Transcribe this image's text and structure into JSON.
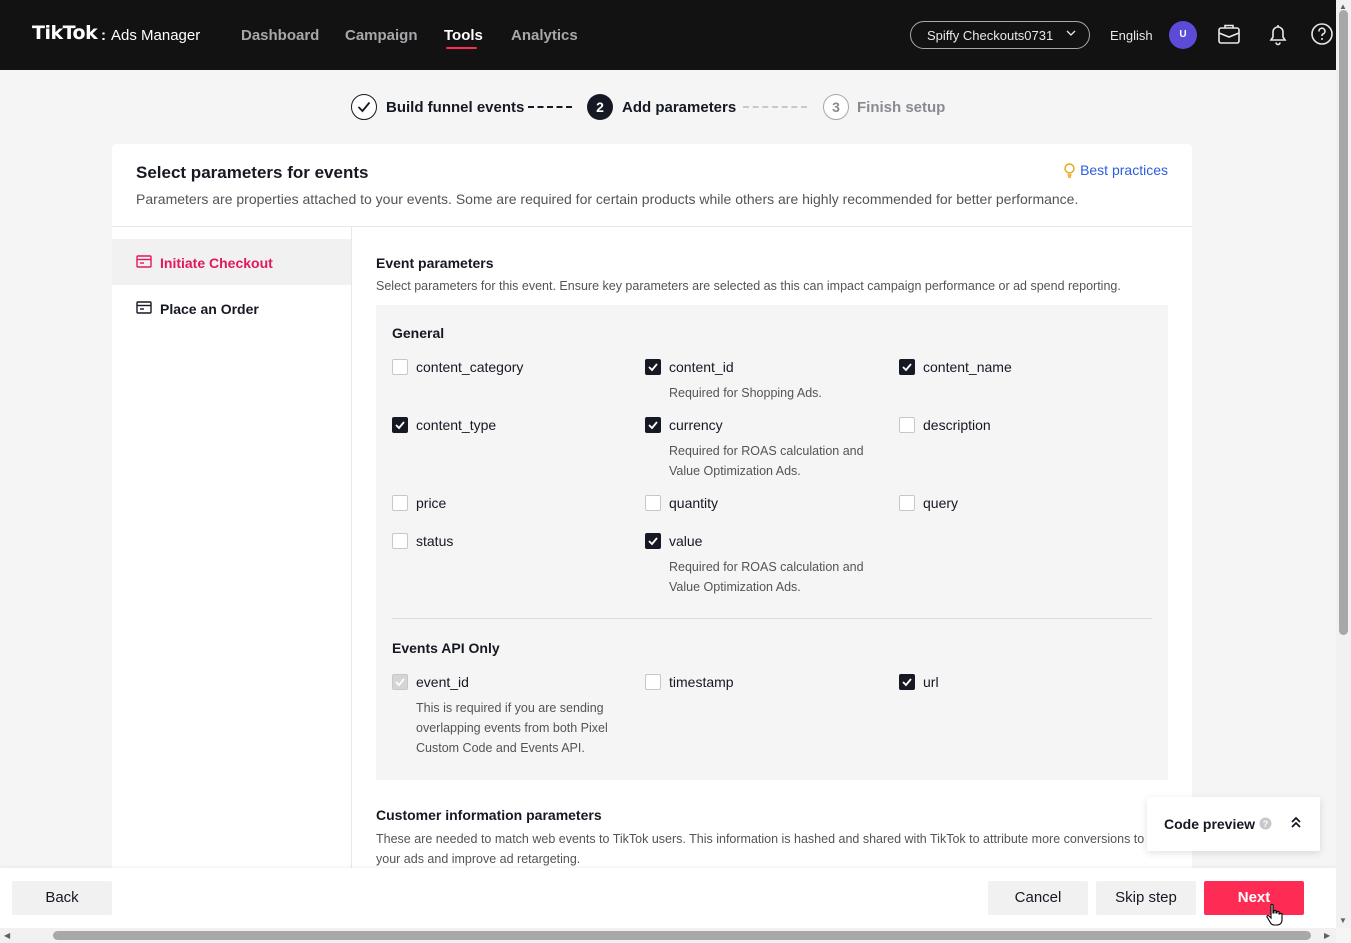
{
  "header": {
    "logo_brand": "TikTok",
    "logo_sub": "Ads Manager",
    "nav": [
      "Dashboard",
      "Campaign",
      "Tools",
      "Analytics"
    ],
    "active_nav": "Tools",
    "account": "Spiffy Checkouts0731",
    "language": "English",
    "avatar_initial": "U"
  },
  "stepper": {
    "steps": [
      {
        "number": "",
        "label": "Build funnel events",
        "state": "done"
      },
      {
        "number": "2",
        "label": "Add parameters",
        "state": "active"
      },
      {
        "number": "3",
        "label": "Finish setup",
        "state": "upcoming"
      }
    ]
  },
  "card": {
    "title": "Select parameters for events",
    "description": "Parameters are properties attached to your events. Some are required for certain products while others are highly recommended for better performance.",
    "best_practices": "Best practices"
  },
  "sidebar": {
    "items": [
      {
        "label": "Initiate Checkout",
        "active": true
      },
      {
        "label": "Place an Order",
        "active": false
      }
    ]
  },
  "event_parameters": {
    "title": "Event parameters",
    "description": "Select parameters for this event. Ensure key parameters are selected as this can impact campaign performance or ad spend reporting.",
    "general": {
      "title": "General",
      "params": [
        {
          "name": "content_category",
          "checked": false,
          "hint": ""
        },
        {
          "name": "content_id",
          "checked": true,
          "hint": "Required for Shopping Ads."
        },
        {
          "name": "content_name",
          "checked": true,
          "hint": ""
        },
        {
          "name": "content_type",
          "checked": true,
          "hint": ""
        },
        {
          "name": "currency",
          "checked": true,
          "hint": "Required for ROAS calculation and Value Optimization Ads."
        },
        {
          "name": "description",
          "checked": false,
          "hint": ""
        },
        {
          "name": "price",
          "checked": false,
          "hint": ""
        },
        {
          "name": "quantity",
          "checked": false,
          "hint": ""
        },
        {
          "name": "query",
          "checked": false,
          "hint": ""
        },
        {
          "name": "status",
          "checked": false,
          "hint": ""
        },
        {
          "name": "value",
          "checked": true,
          "hint": "Required for ROAS calculation and Value Optimization Ads."
        }
      ]
    },
    "events_api": {
      "title": "Events API Only",
      "params": [
        {
          "name": "event_id",
          "checked": true,
          "disabled": true,
          "hint": "This is required if you are sending overlapping events from both Pixel Custom Code and Events API."
        },
        {
          "name": "timestamp",
          "checked": false,
          "hint": ""
        },
        {
          "name": "url",
          "checked": true,
          "hint": ""
        }
      ]
    }
  },
  "customer_info": {
    "title": "Customer information parameters",
    "description": "These are needed to match web events to TikTok users. This information is hashed and shared with TikTok to attribute more conversions to your ads and improve ad retargeting."
  },
  "code_preview": {
    "label": "Code preview"
  },
  "footer": {
    "back": "Back",
    "cancel": "Cancel",
    "skip": "Skip step",
    "next": "Next"
  },
  "colors": {
    "primary": "#fe2c55",
    "active_text": "#e3175d",
    "link": "#2b5de0",
    "topbar": "#121212"
  }
}
